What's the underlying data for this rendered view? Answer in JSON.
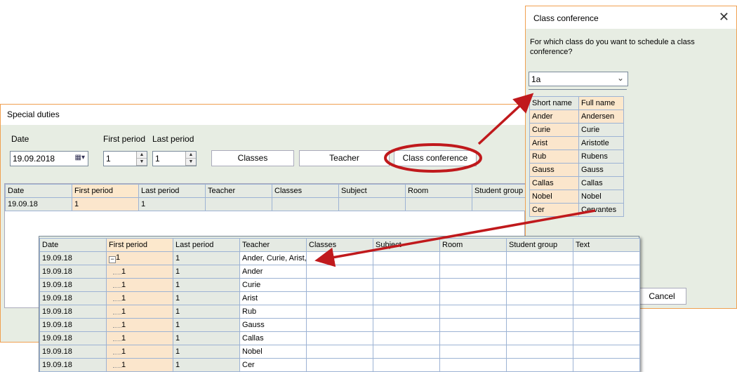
{
  "special_duties": {
    "title": "Special duties",
    "date_label": "Date",
    "first_period_label": "First period",
    "last_period_label": "Last period",
    "date_value": "19.09.2018",
    "first_period_value": "1",
    "last_period_value": "1",
    "buttons": {
      "classes": "Classes",
      "teacher": "Teacher",
      "class_conference": "Class conference"
    },
    "columns": [
      "Date",
      "First period",
      "Last period",
      "Teacher",
      "Classes",
      "Subject",
      "Room",
      "Student group"
    ],
    "row": {
      "date": "19.09.18",
      "first": "1",
      "last": "1"
    }
  },
  "class_conference": {
    "title": "Class conference",
    "close": "✕",
    "question": "For which class do you want to schedule a class conference?",
    "class_select": "1a",
    "columns": [
      "Short name",
      "Full name"
    ],
    "rows": [
      [
        "Ander",
        "Andersen"
      ],
      [
        "Curie",
        "Curie"
      ],
      [
        "Arist",
        "Aristotle"
      ],
      [
        "Rub",
        "Rubens"
      ],
      [
        "Gauss",
        "Gauss"
      ],
      [
        "Callas",
        "Callas"
      ],
      [
        "Nobel",
        "Nobel"
      ],
      [
        "Cer",
        "Cervantes"
      ]
    ],
    "cancel": "Cancel"
  },
  "result_grid": {
    "columns": [
      "Date",
      "First period",
      "Last period",
      "Teacher",
      "Classes",
      "Subject",
      "Room",
      "Student group",
      "Text"
    ],
    "parent_row": {
      "date": "19.09.18",
      "first": "1",
      "last": "1",
      "teacher": "Ander, Curie, Arist,"
    },
    "rows": [
      {
        "date": "19.09.18",
        "first": "1",
        "last": "1",
        "teacher": "Ander"
      },
      {
        "date": "19.09.18",
        "first": "1",
        "last": "1",
        "teacher": "Curie"
      },
      {
        "date": "19.09.18",
        "first": "1",
        "last": "1",
        "teacher": "Arist"
      },
      {
        "date": "19.09.18",
        "first": "1",
        "last": "1",
        "teacher": "Rub"
      },
      {
        "date": "19.09.18",
        "first": "1",
        "last": "1",
        "teacher": "Gauss"
      },
      {
        "date": "19.09.18",
        "first": "1",
        "last": "1",
        "teacher": "Callas"
      },
      {
        "date": "19.09.18",
        "first": "1",
        "last": "1",
        "teacher": "Nobel"
      },
      {
        "date": "19.09.18",
        "first": "1",
        "last": "1",
        "teacher": "Cer"
      }
    ]
  },
  "colors": {
    "highlight": "#fbe6cc",
    "panel": "#e7ede3",
    "annotation": "#c0191c"
  }
}
